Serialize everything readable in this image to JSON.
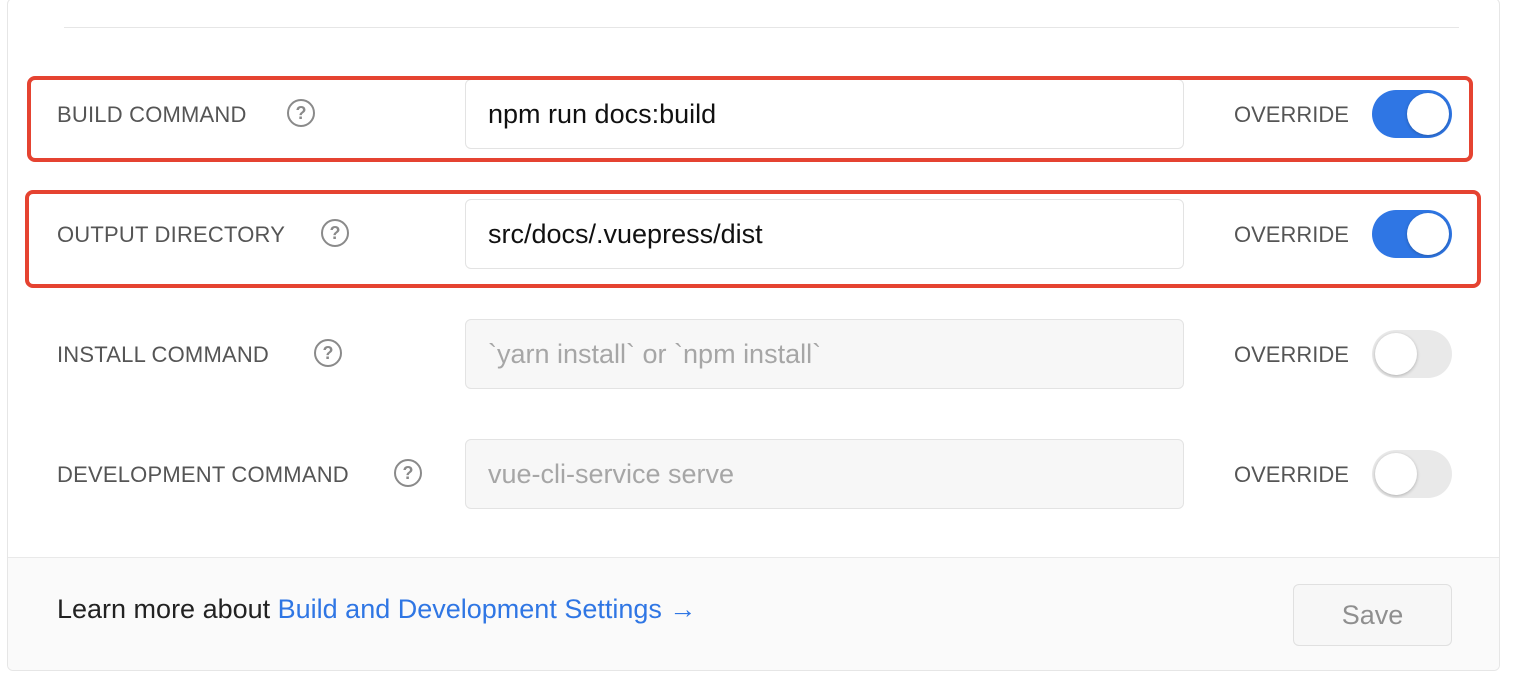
{
  "rows": [
    {
      "label": "BUILD COMMAND",
      "value": "npm run docs:build",
      "placeholder": "",
      "override_label": "OVERRIDE",
      "override_on": true,
      "highlighted": true
    },
    {
      "label": "OUTPUT DIRECTORY",
      "value": "src/docs/.vuepress/dist",
      "placeholder": "",
      "override_label": "OVERRIDE",
      "override_on": true,
      "highlighted": true
    },
    {
      "label": "INSTALL COMMAND",
      "value": "",
      "placeholder": "`yarn install` or `npm install`",
      "override_label": "OVERRIDE",
      "override_on": false,
      "highlighted": false
    },
    {
      "label": "DEVELOPMENT COMMAND",
      "value": "",
      "placeholder": "vue-cli-service serve",
      "override_label": "OVERRIDE",
      "override_on": false,
      "highlighted": false
    }
  ],
  "help_glyph": "?",
  "footer": {
    "learn_prefix": "Learn more about ",
    "learn_link": "Build and Development Settings →",
    "save_label": "Save"
  },
  "colors": {
    "accent": "#2f76e4",
    "highlight": "#e54331"
  }
}
